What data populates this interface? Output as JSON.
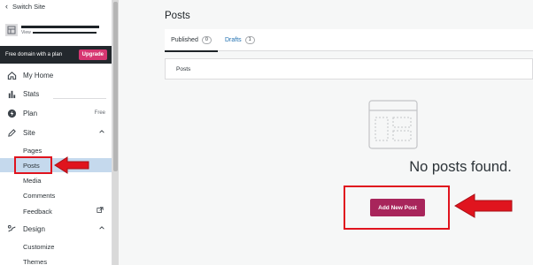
{
  "sidebar": {
    "switch_site_label": "Switch Site",
    "site_url_prefix": "View",
    "banner_text": "Free domain with a plan",
    "upgrade_label": "Upgrade",
    "items": [
      {
        "label": "My Home",
        "icon": "home-icon"
      },
      {
        "label": "Stats",
        "icon": "stats-icon"
      },
      {
        "label": "Plan",
        "icon": "plan-icon",
        "badge": "Free"
      },
      {
        "label": "Site",
        "icon": "site-icon",
        "expanded": true
      },
      {
        "label": "Feedback"
      },
      {
        "label": "Design",
        "icon": "design-icon",
        "expanded": true
      }
    ],
    "site_subitems": [
      "Pages",
      "Posts",
      "Media",
      "Comments"
    ],
    "design_subitems": [
      "Customize",
      "Themes"
    ],
    "active_subitem": "Posts"
  },
  "main": {
    "title": "Posts",
    "tabs": [
      {
        "label": "Published",
        "count": "0"
      },
      {
        "label": "Drafts",
        "count": "1"
      }
    ],
    "list_header": "Posts",
    "empty_message": "No posts found.",
    "add_button_label": "Add New Post"
  },
  "colors": {
    "accent": "#a8255b",
    "upgrade": "#d63671",
    "annotation": "#e0141e",
    "active_bg": "#c5d9ed",
    "link": "#2271b1"
  }
}
